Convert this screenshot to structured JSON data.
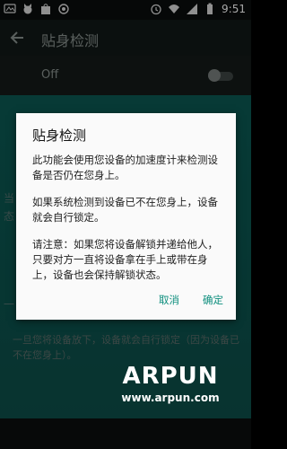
{
  "status_bar": {
    "time": "9:51"
  },
  "toolbar": {
    "title": "贴身检测"
  },
  "setting": {
    "off_label": "Off"
  },
  "background": {
    "footer_text": "一旦您将设备放下，设备就会自行锁定（因为设备已不在您身上）。"
  },
  "dialog": {
    "title": "贴身检测",
    "paragraphs": [
      "此功能会使用您设备的加速度计来检测设备是否仍在您身上。",
      "如果系统检测到设备已不在您身上，设备就会自行锁定。",
      "请注意：如果您将设备解锁并递给他人，只要对方一直将设备拿在手上或带在身上，设备也会保持解锁状态。"
    ],
    "cancel_label": "取消",
    "ok_label": "确定"
  },
  "watermark": {
    "brand": "ARPUN",
    "url": "www.arpun.com"
  },
  "colors": {
    "accent": "#0f8f7e",
    "teal_bg": "#0b5a54",
    "toolbar_bg": "#121917"
  }
}
